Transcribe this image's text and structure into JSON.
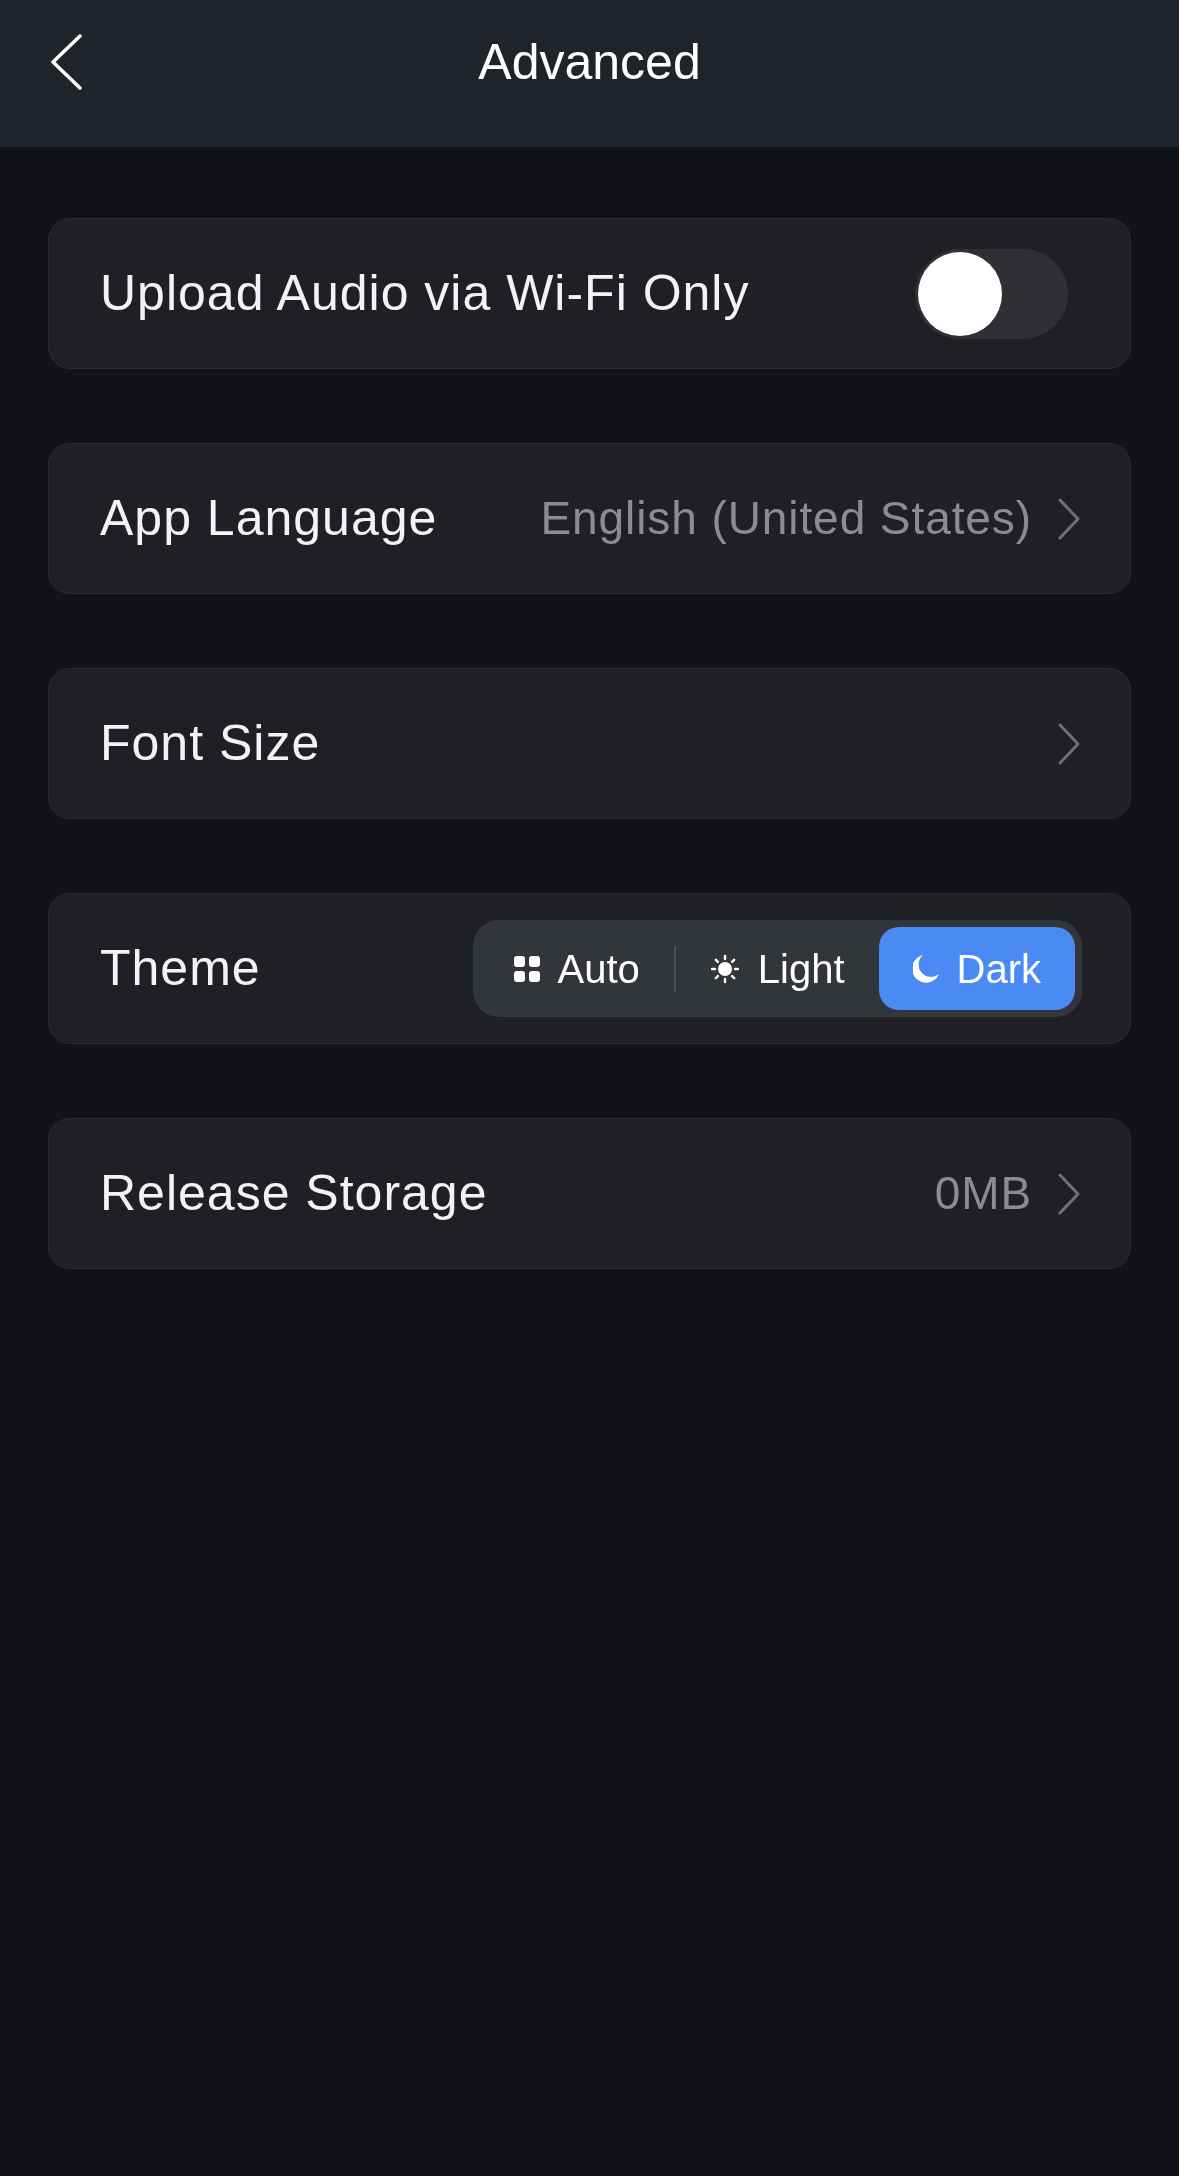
{
  "header": {
    "title": "Advanced"
  },
  "settings": [
    {
      "kind": "toggle",
      "label": "Upload Audio via Wi-Fi Only",
      "on": false
    },
    {
      "kind": "link",
      "label": "App Language",
      "value": "English (United States)"
    },
    {
      "kind": "link",
      "label": "Font Size"
    },
    {
      "kind": "segmented",
      "label": "Theme",
      "options": [
        {
          "label": "Auto",
          "selected": false
        },
        {
          "label": "Light",
          "selected": false
        },
        {
          "label": "Dark",
          "selected": true
        }
      ]
    },
    {
      "kind": "link",
      "label": "Release Storage",
      "value": "0MB"
    }
  ]
}
